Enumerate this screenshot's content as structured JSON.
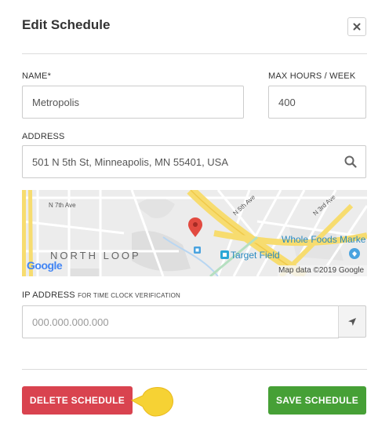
{
  "dialog": {
    "title": "Edit Schedule",
    "close_icon": "close-icon"
  },
  "fields": {
    "name": {
      "label": "NAME*",
      "value": "Metropolis"
    },
    "max_hours": {
      "label": "MAX HOURS / WEEK",
      "value": "400"
    },
    "address": {
      "label": "ADDRESS",
      "value": "501 N 5th St, Minneapolis, MN 55401, USA",
      "icon": "search-icon"
    },
    "ip_address": {
      "label": "IP ADDRESS",
      "sublabel": "FOR TIME CLOCK VERIFICATION",
      "placeholder": "000.000.000.000",
      "icon": "location-arrow-icon"
    }
  },
  "map": {
    "streets": [
      "N 7th Ave",
      "N 5th Ave",
      "N 3rd Ave"
    ],
    "neighborhood": "NORTH LOOP",
    "poi": [
      "Target Field",
      "Whole Foods Marke"
    ],
    "logo": "Google",
    "attribution": "Map data ©2019 Google"
  },
  "buttons": {
    "delete": "DELETE SCHEDULE",
    "save": "SAVE SCHEDULE"
  },
  "colors": {
    "delete": "#d9434f",
    "save": "#46a036",
    "highlight": "#f6d234"
  }
}
